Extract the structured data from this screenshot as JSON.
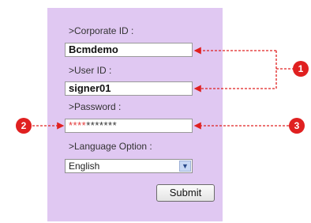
{
  "form": {
    "corporate_id_label": ">Corporate ID :",
    "corporate_id_value": "Bcmdemo",
    "user_id_label": ">User ID :",
    "user_id_value": "signer01",
    "password_label": ">Password :",
    "password_mask_red": "****",
    "password_mask_dark": "*******",
    "language_label": ">Language Option :",
    "language_selected": "English",
    "submit_label": "Submit"
  },
  "annotations": {
    "badge_1": "1",
    "badge_2": "2",
    "badge_3": "3"
  },
  "colors": {
    "panel_background": "#e0c8f2",
    "annotation_red": "#e02020"
  }
}
